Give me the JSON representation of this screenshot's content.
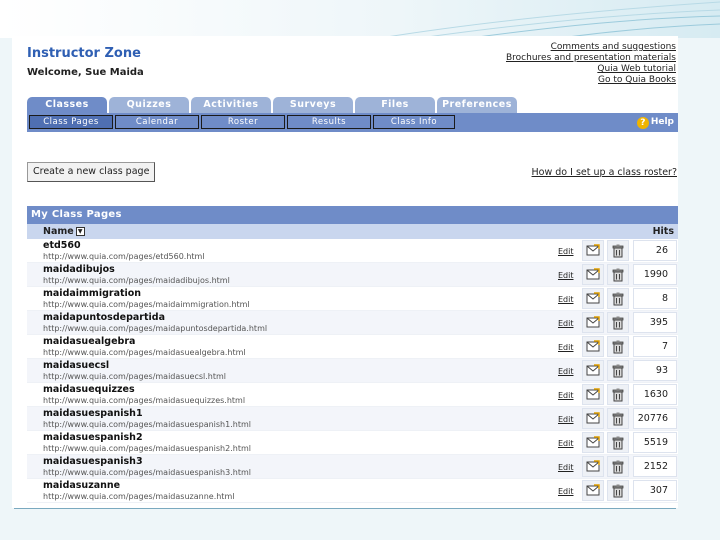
{
  "header": {
    "brand": "Instructor Zone",
    "welcome": "Welcome, Sue Maida",
    "links": [
      "Comments and suggestions",
      "Brochures and presentation materials",
      "Quia Web tutorial",
      "Go to Quia Books"
    ]
  },
  "tabs": [
    "Classes",
    "Quizzes",
    "Activities",
    "Surveys",
    "Files",
    "Preferences"
  ],
  "active_tab": "Classes",
  "subtabs": [
    "Class Pages",
    "Calendar",
    "Roster",
    "Results",
    "Class Info"
  ],
  "active_subtab": "Class Pages",
  "help_label": "Help",
  "create_button": "Create a new class page",
  "roster_help_link": "How do I set up a class roster?",
  "list": {
    "title": "My Class Pages",
    "col_name": "Name",
    "col_hits": "Hits",
    "edit_label": "Edit",
    "rows": [
      {
        "name": "etd560",
        "url": "http://www.quia.com/pages/etd560.html",
        "hits": "26"
      },
      {
        "name": "maidadibujos",
        "url": "http://www.quia.com/pages/maidadibujos.html",
        "hits": "1990"
      },
      {
        "name": "maidaimmigration",
        "url": "http://www.quia.com/pages/maidaimmigration.html",
        "hits": "8"
      },
      {
        "name": "maidapuntosdepartida",
        "url": "http://www.quia.com/pages/maidapuntosdepartida.html",
        "hits": "395"
      },
      {
        "name": "maidasuealgebra",
        "url": "http://www.quia.com/pages/maidasuealgebra.html",
        "hits": "7"
      },
      {
        "name": "maidasuecsl",
        "url": "http://www.quia.com/pages/maidasuecsl.html",
        "hits": "93"
      },
      {
        "name": "maidasuequizzes",
        "url": "http://www.quia.com/pages/maidasuequizzes.html",
        "hits": "1630"
      },
      {
        "name": "maidasuespanish1",
        "url": "http://www.quia.com/pages/maidasuespanish1.html",
        "hits": "20776"
      },
      {
        "name": "maidasuespanish2",
        "url": "http://www.quia.com/pages/maidasuespanish2.html",
        "hits": "5519"
      },
      {
        "name": "maidasuespanish3",
        "url": "http://www.quia.com/pages/maidasuespanish3.html",
        "hits": "2152"
      },
      {
        "name": "maidasuzanne",
        "url": "http://www.quia.com/pages/maidasuzanne.html",
        "hits": "307"
      }
    ]
  },
  "colors": {
    "brand": "#2f5fb3",
    "tab": "#9eb3d8",
    "tab_active": "#6f8cc8",
    "header_bar": "#6f8cc8",
    "column_header": "#c9d6ee"
  },
  "icons": {
    "mail": "envelope-icon",
    "delete": "trash-icon",
    "sort": "sort-down-icon",
    "help": "help-icon"
  }
}
